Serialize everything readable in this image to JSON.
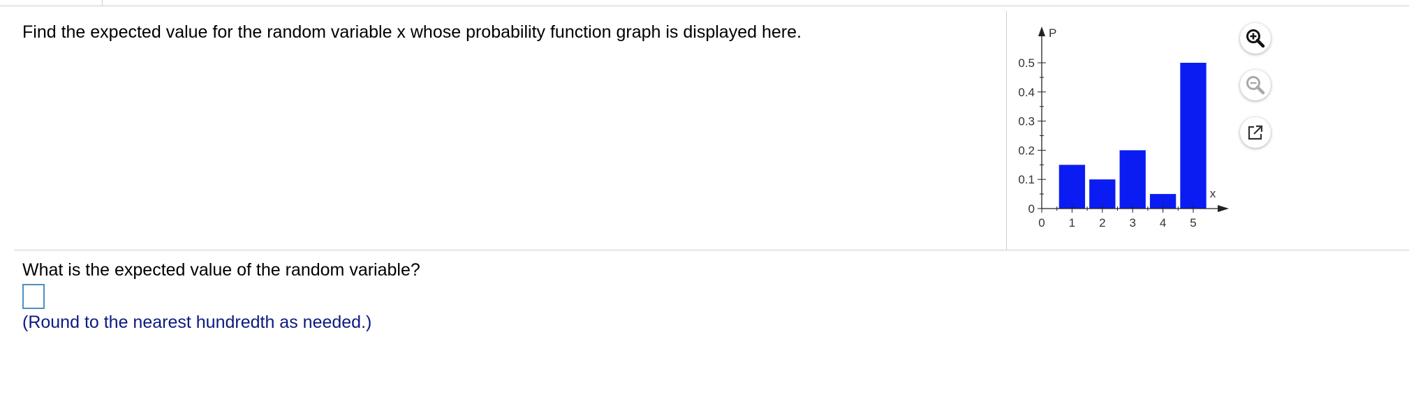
{
  "question": {
    "text": "Find the expected value for the random variable x whose probability function graph is displayed here.",
    "prompt": "What is the expected value of the random variable?",
    "answer_value": "",
    "hint": "(Round to the nearest hundredth as needed.)"
  },
  "tools": {
    "zoom_in_icon": "zoom-in",
    "zoom_out_icon": "zoom-out",
    "open_icon": "external-link"
  },
  "colors": {
    "bar": "#0a1cf2",
    "hint": "#0b1a80",
    "answer_border": "#4a90c4",
    "divider": "#c9ccd6"
  },
  "chart_data": {
    "type": "bar",
    "categories": [
      "1",
      "2",
      "3",
      "4",
      "5"
    ],
    "values": [
      0.15,
      0.1,
      0.2,
      0.05,
      0.5
    ],
    "title": "",
    "xlabel": "x",
    "ylabel": "P",
    "ylim": [
      0,
      0.5
    ],
    "xlim": [
      0,
      5
    ],
    "x_ticks": [
      "0",
      "1",
      "2",
      "3",
      "4",
      "5"
    ],
    "y_ticks": [
      "0",
      "0.1",
      "0.2",
      "0.3",
      "0.4",
      "0.5"
    ],
    "grid": false
  }
}
